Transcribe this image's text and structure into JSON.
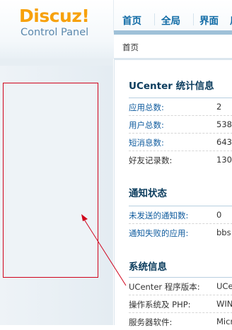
{
  "logo": {
    "main": "Discuz!",
    "sub": "Control Panel"
  },
  "nav": [
    "首页",
    "全局",
    "界面",
    "用"
  ],
  "breadcrumb": "首页",
  "sections": {
    "stats": {
      "title": "UCenter 统计信息",
      "rows": [
        {
          "label": "应用总数:",
          "value": "2"
        },
        {
          "label": "用户总数:",
          "value": "538"
        },
        {
          "label": "短消息数:",
          "value": "643"
        },
        {
          "label": "好友记录数:",
          "value": "130"
        }
      ]
    },
    "notify": {
      "title": "通知状态",
      "rows": [
        {
          "label": "未发送的通知数:",
          "value": "0"
        },
        {
          "label": "通知失败的应用:",
          "value": "bbs"
        }
      ]
    },
    "system": {
      "title": "系统信息",
      "rows": [
        {
          "label": "UCenter 程序版本:",
          "value": "UCe"
        },
        {
          "label": "操作系统及 PHP:",
          "value": "WIN"
        },
        {
          "label": "服务器软件:",
          "value": "Micr"
        }
      ]
    }
  },
  "colors": {
    "logo_orange": "#f7a10c",
    "logo_blue": "#5b88ad",
    "nav_blue": "#0f6aa5",
    "title_navy": "#0b3c5d",
    "annotation_red": "#d0021b"
  }
}
